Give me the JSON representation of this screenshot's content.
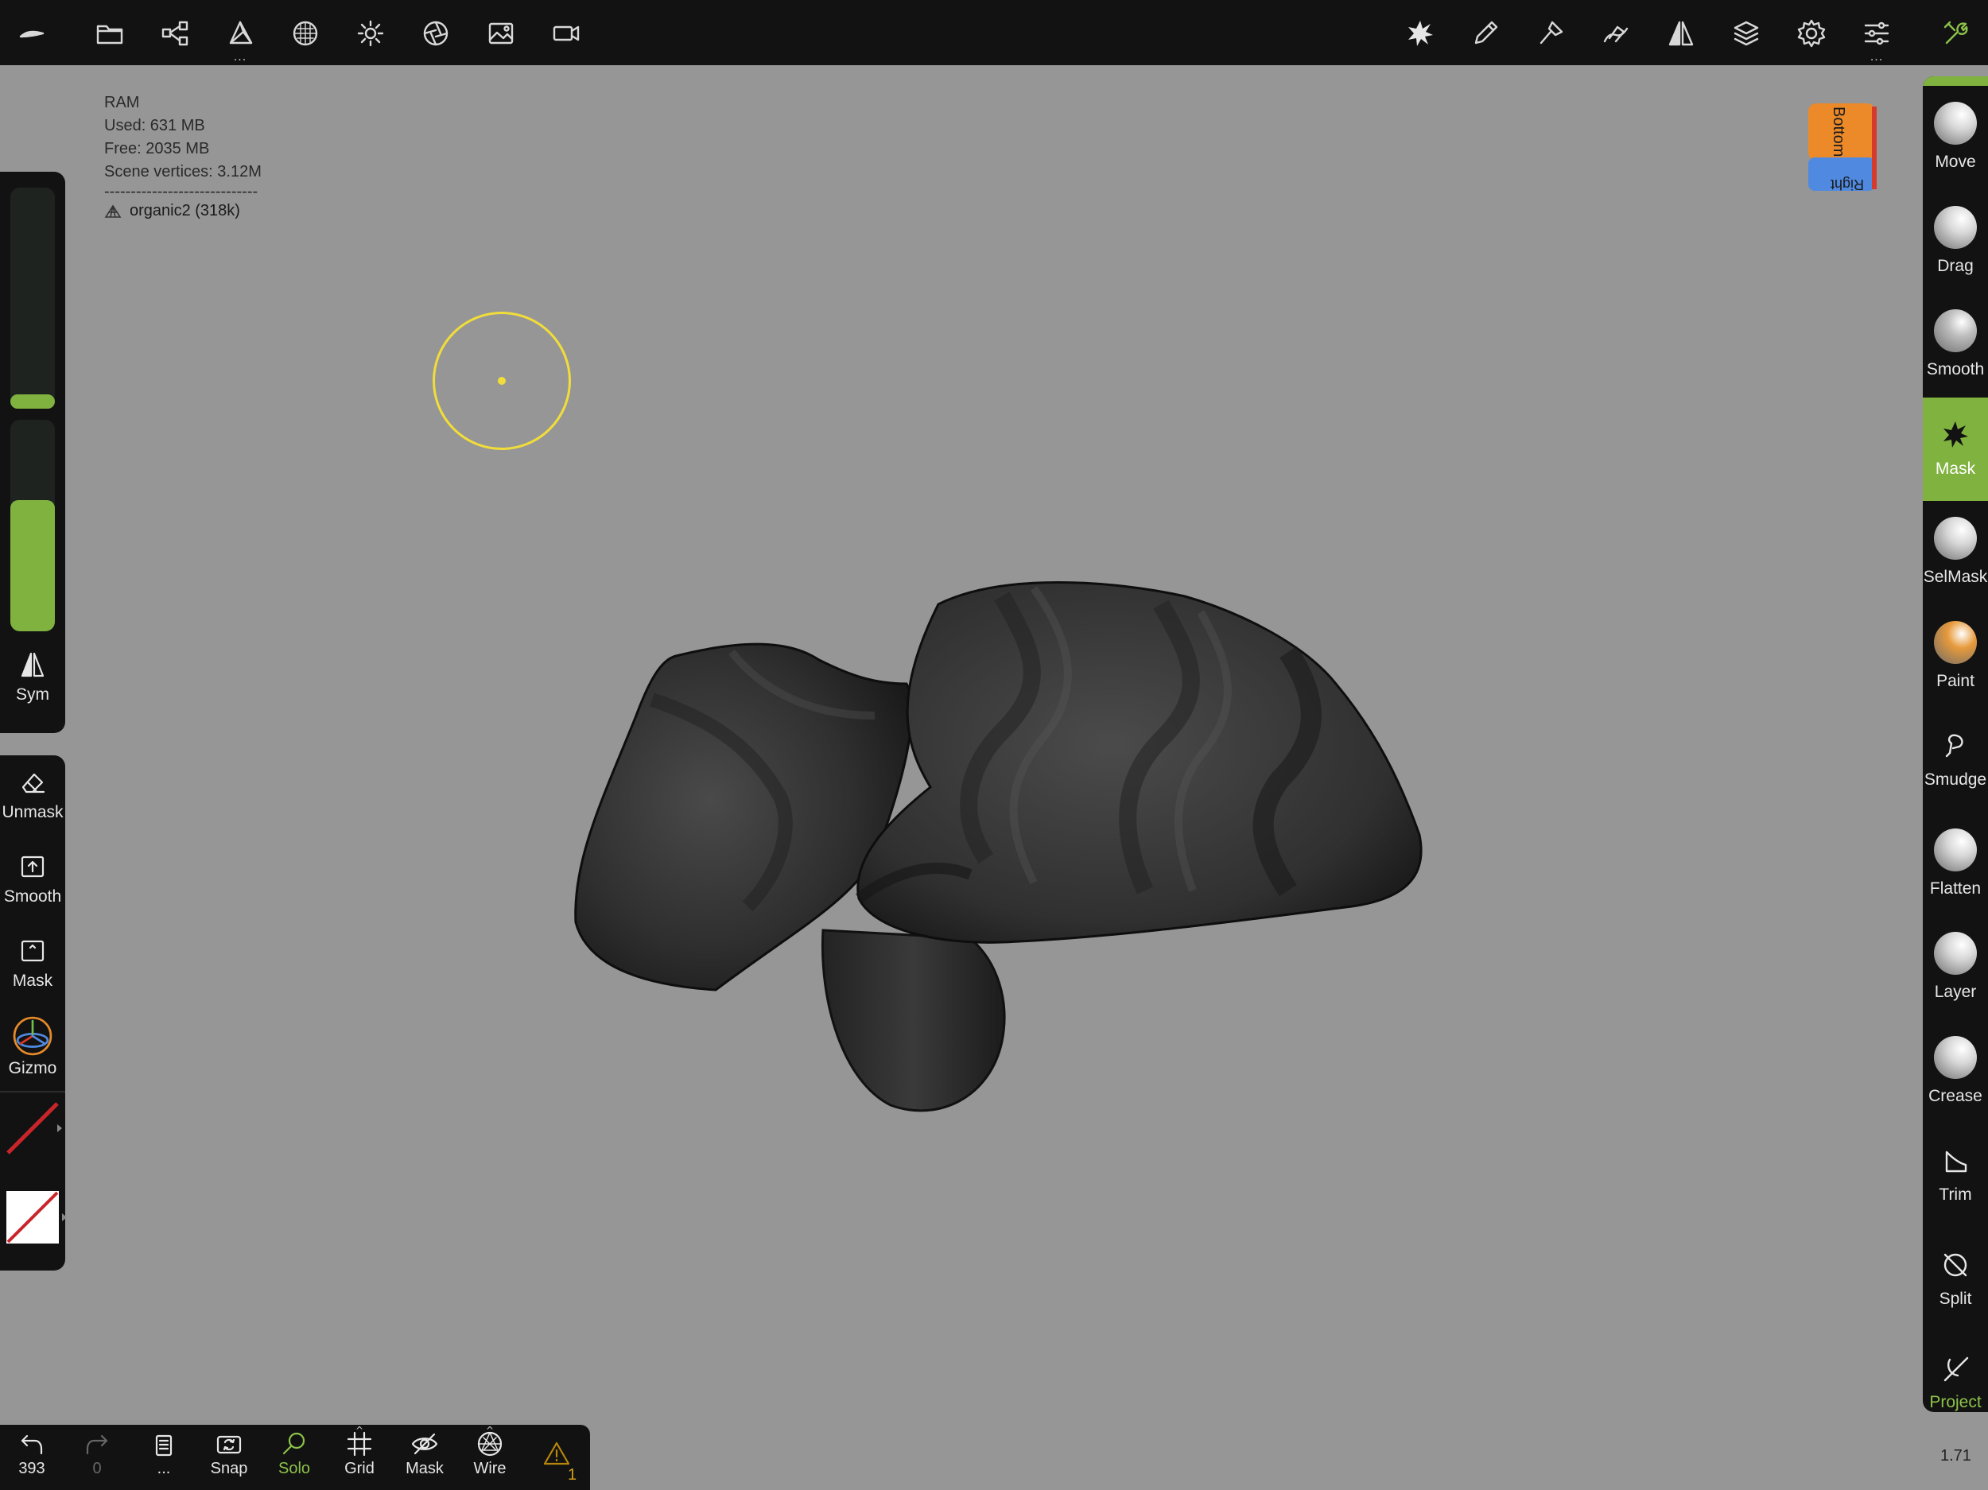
{
  "stats": {
    "ram_label": "RAM",
    "used": "Used: 631 MB",
    "free": "Free: 2035 MB",
    "vertices": "Scene vertices: 3.12M",
    "divider": "-----------------------------",
    "mesh_name": "organic2 (318k)"
  },
  "topbar": {
    "left_icons": [
      "logo-icon",
      "folder-icon",
      "scene-tree-icon",
      "topology-icon",
      "material-icon",
      "light-icon",
      "postprocess-icon",
      "background-icon",
      "camera-icon"
    ],
    "right_icons": [
      "mask-tool-icon",
      "stroke-icon",
      "brush-icon",
      "painting-icon",
      "symmetry-icon",
      "layers-icon",
      "settings-icon",
      "interface-icon",
      "tools-icon"
    ],
    "accent": "#7fb23e"
  },
  "viewcube": {
    "top_face": "Bottom",
    "side_face": "Right"
  },
  "left_panel": {
    "radius_level": 0.06,
    "intensity_level": 0.62,
    "sym_label": "Sym",
    "unmask_label": "Unmask",
    "smooth_label": "Smooth",
    "mask_label": "Mask",
    "gizmo_label": "Gizmo"
  },
  "tools": [
    {
      "label": "Move",
      "kind": "sphere",
      "color": "#d8d8d8"
    },
    {
      "label": "Drag",
      "kind": "sphere",
      "color": "#d8d8d8"
    },
    {
      "label": "Smooth",
      "kind": "sphere",
      "color": "#bdbdbd"
    },
    {
      "label": "Mask",
      "kind": "icon",
      "active": true
    },
    {
      "label": "SelMask",
      "kind": "sphere",
      "color": "#d8d8d8"
    },
    {
      "label": "Paint",
      "kind": "sphere",
      "color": "#e79a3c"
    },
    {
      "label": "Smudge",
      "kind": "icon"
    },
    {
      "label": "Flatten",
      "kind": "sphere",
      "color": "#d8d8d8"
    },
    {
      "label": "Layer",
      "kind": "sphere",
      "color": "#d8d8d8"
    },
    {
      "label": "Crease",
      "kind": "sphere",
      "color": "#d8d8d8"
    },
    {
      "label": "Trim",
      "kind": "icon"
    },
    {
      "label": "Split",
      "kind": "icon"
    },
    {
      "label": "Project",
      "kind": "icon"
    }
  ],
  "bottombar": {
    "undo_count": "393",
    "redo_count": "0",
    "more_label": "...",
    "snap_label": "Snap",
    "solo_label": "Solo",
    "grid_label": "Grid",
    "mask_label": "Mask",
    "wire_label": "Wire",
    "warning_count": "1"
  },
  "version": "1.71"
}
